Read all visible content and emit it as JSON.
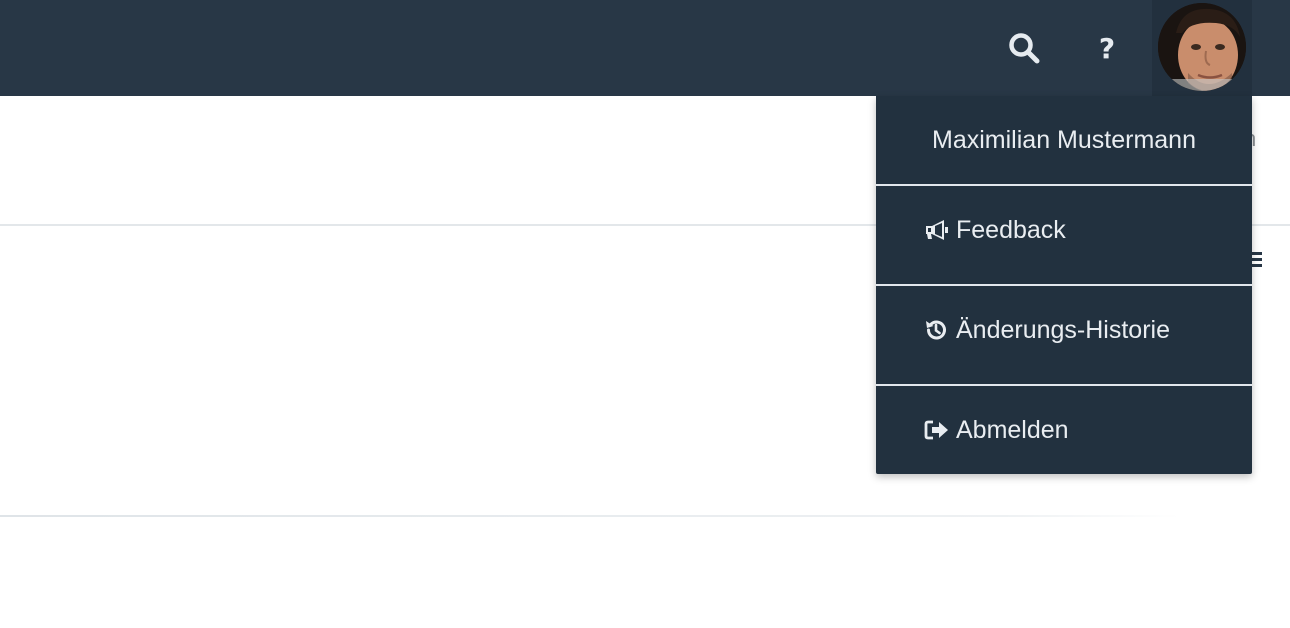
{
  "header": {
    "search_icon": "search-icon",
    "help_label": "?",
    "avatar_icon": "user-avatar"
  },
  "content": {
    "right_edge_text": "n",
    "right_edge_icon": "menu-icon"
  },
  "user_menu": {
    "user_name": "Maximilian Mustermann",
    "items": [
      {
        "label": "Feedback",
        "icon": "megaphone-icon"
      },
      {
        "label": "Änderungs-Historie",
        "icon": "history-icon"
      },
      {
        "label": "Abmelden",
        "icon": "sign-out-icon"
      }
    ]
  },
  "colors": {
    "topbar_bg": "#283746",
    "dropdown_bg": "#22313f",
    "menu_text": "#e9edf1"
  }
}
